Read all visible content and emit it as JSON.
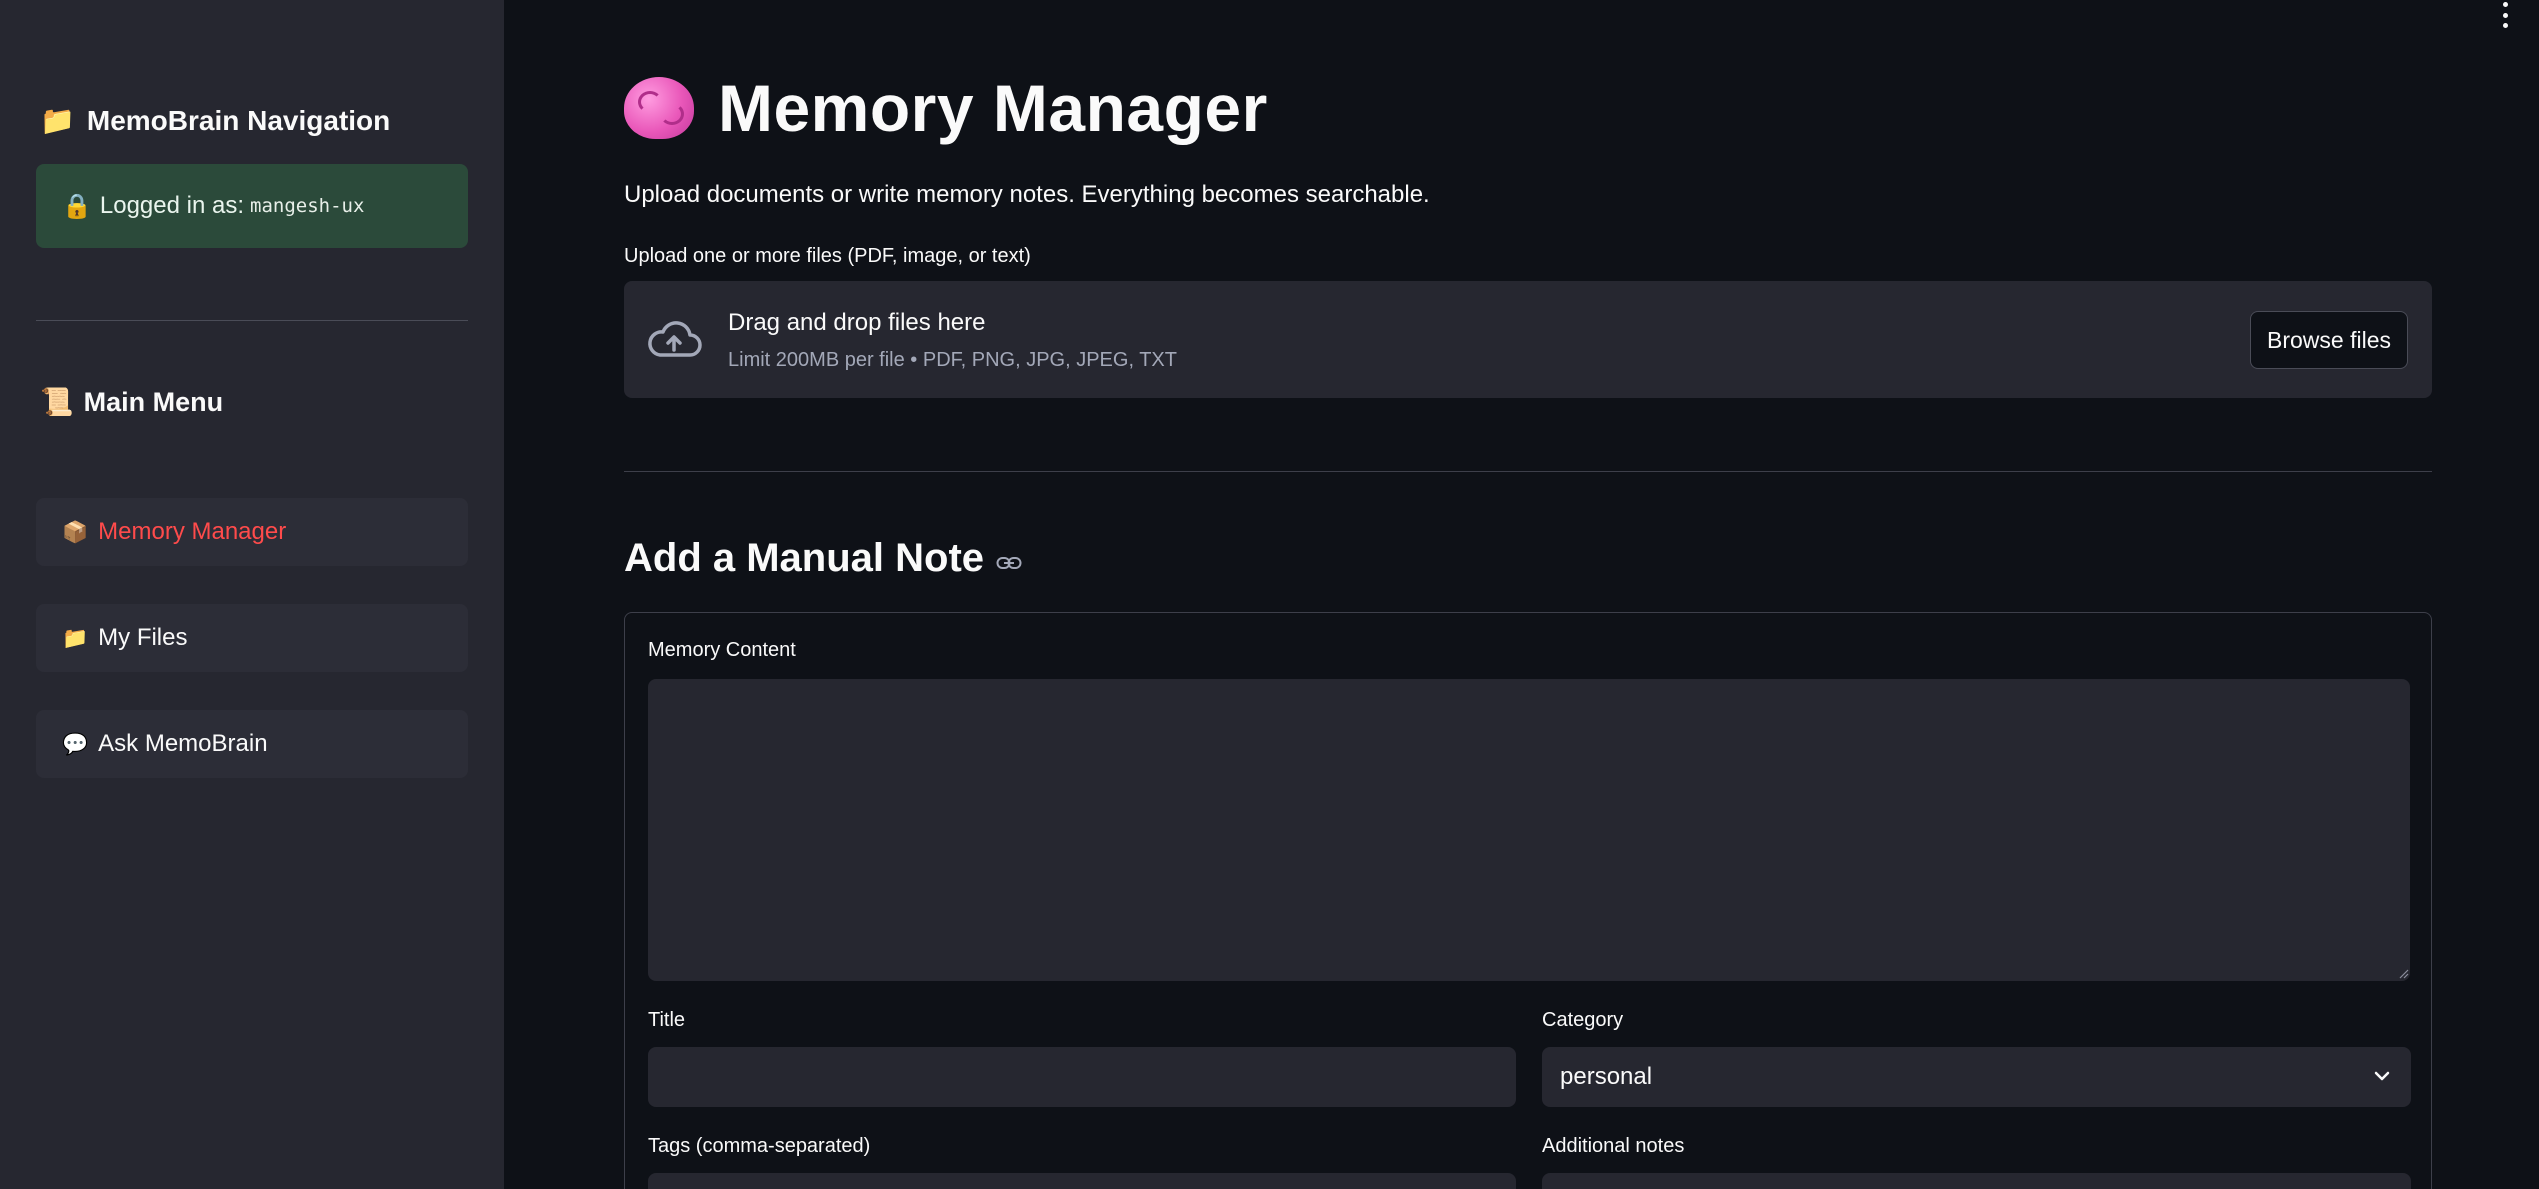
{
  "sidebar": {
    "title": "MemoBrain Navigation",
    "title_icon": "folder-icon",
    "login": {
      "prefix": "Logged in as:",
      "username": "mangesh-ux",
      "icon": "lock-icon"
    },
    "menu_title": "Main Menu",
    "menu_icon": "scroll-icon",
    "items": [
      {
        "label": "Memory Manager",
        "icon": "package-icon",
        "active": true
      },
      {
        "label": "My Files",
        "icon": "folder-icon",
        "active": false
      },
      {
        "label": "Ask MemoBrain",
        "icon": "speech-balloon-icon",
        "active": false
      }
    ]
  },
  "main": {
    "title": "Memory Manager",
    "title_icon": "brain-icon",
    "subtitle": "Upload documents or write memory notes. Everything becomes searchable.",
    "upload": {
      "label": "Upload one or more files (PDF, image, or text)",
      "drop_text": "Drag and drop files here",
      "limit_text": "Limit 200MB per file • PDF, PNG, JPG, JPEG, TXT",
      "browse_label": "Browse files"
    },
    "section_title": "Add a Manual Note",
    "form": {
      "content_label": "Memory Content",
      "content_value": "",
      "title_label": "Title",
      "title_value": "",
      "category_label": "Category",
      "category_value": "personal",
      "tags_label": "Tags (comma-separated)",
      "tags_value": "",
      "notes_label": "Additional notes",
      "notes_value": ""
    }
  },
  "colors": {
    "background": "#0e1117",
    "sidebar": "#262730",
    "accent": "#ff4b4b",
    "success_box": "#2b4a3a"
  }
}
